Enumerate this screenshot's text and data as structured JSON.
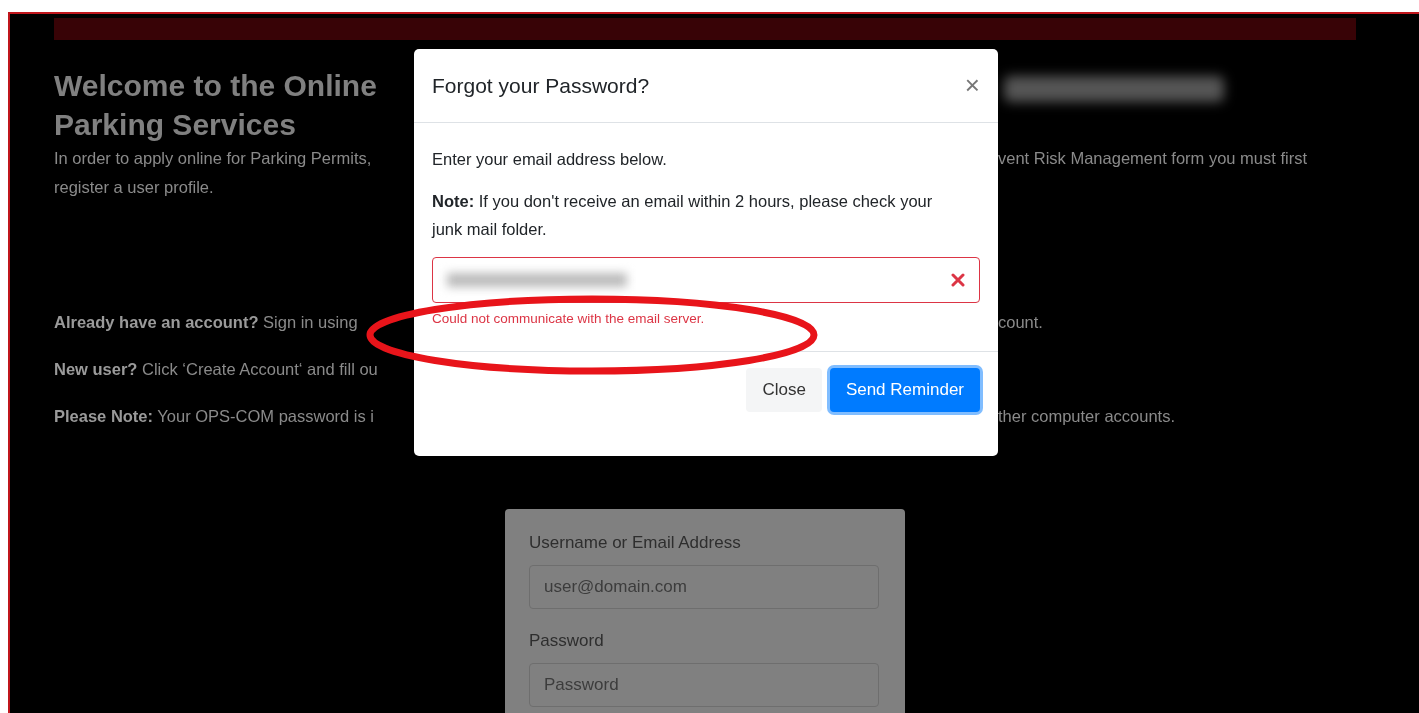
{
  "background": {
    "heading": [
      "Welcome to the Online",
      "Parking Services"
    ],
    "intro_left": [
      "In order to apply online for Parking Permits,",
      "register a user profile."
    ],
    "intro_right": "vent Risk Management form you must first",
    "notes": [
      {
        "left": "**Already have an account?** Sign in using",
        "right": "count."
      },
      {
        "left": "**New user?** Click ‘Create Account‘ and fill ou"
      },
      {
        "left": "**Please Note:** Your OPS-COM password is i",
        "right": "ther computer accounts."
      }
    ]
  },
  "login_form": {
    "fields": [
      {
        "label": "Username or Email Address",
        "placeholder": "user@domain.com"
      },
      {
        "label": "Password",
        "placeholder": "Password"
      }
    ]
  },
  "dialog": {
    "title": "Forgot your Password?",
    "close_symbol": "×",
    "instruction": "Enter your email address below.",
    "note": "**Note:** If you don't receive an email within 2 hours, please check your junk mail folder.",
    "email_field": {
      "invalid": true,
      "error": "Could not communicate with the email server."
    },
    "buttons": [
      {
        "label": "Close",
        "kind": "secondary",
        "focused": false
      },
      {
        "label": "Send Reminder",
        "kind": "primary",
        "focused": true
      }
    ]
  }
}
